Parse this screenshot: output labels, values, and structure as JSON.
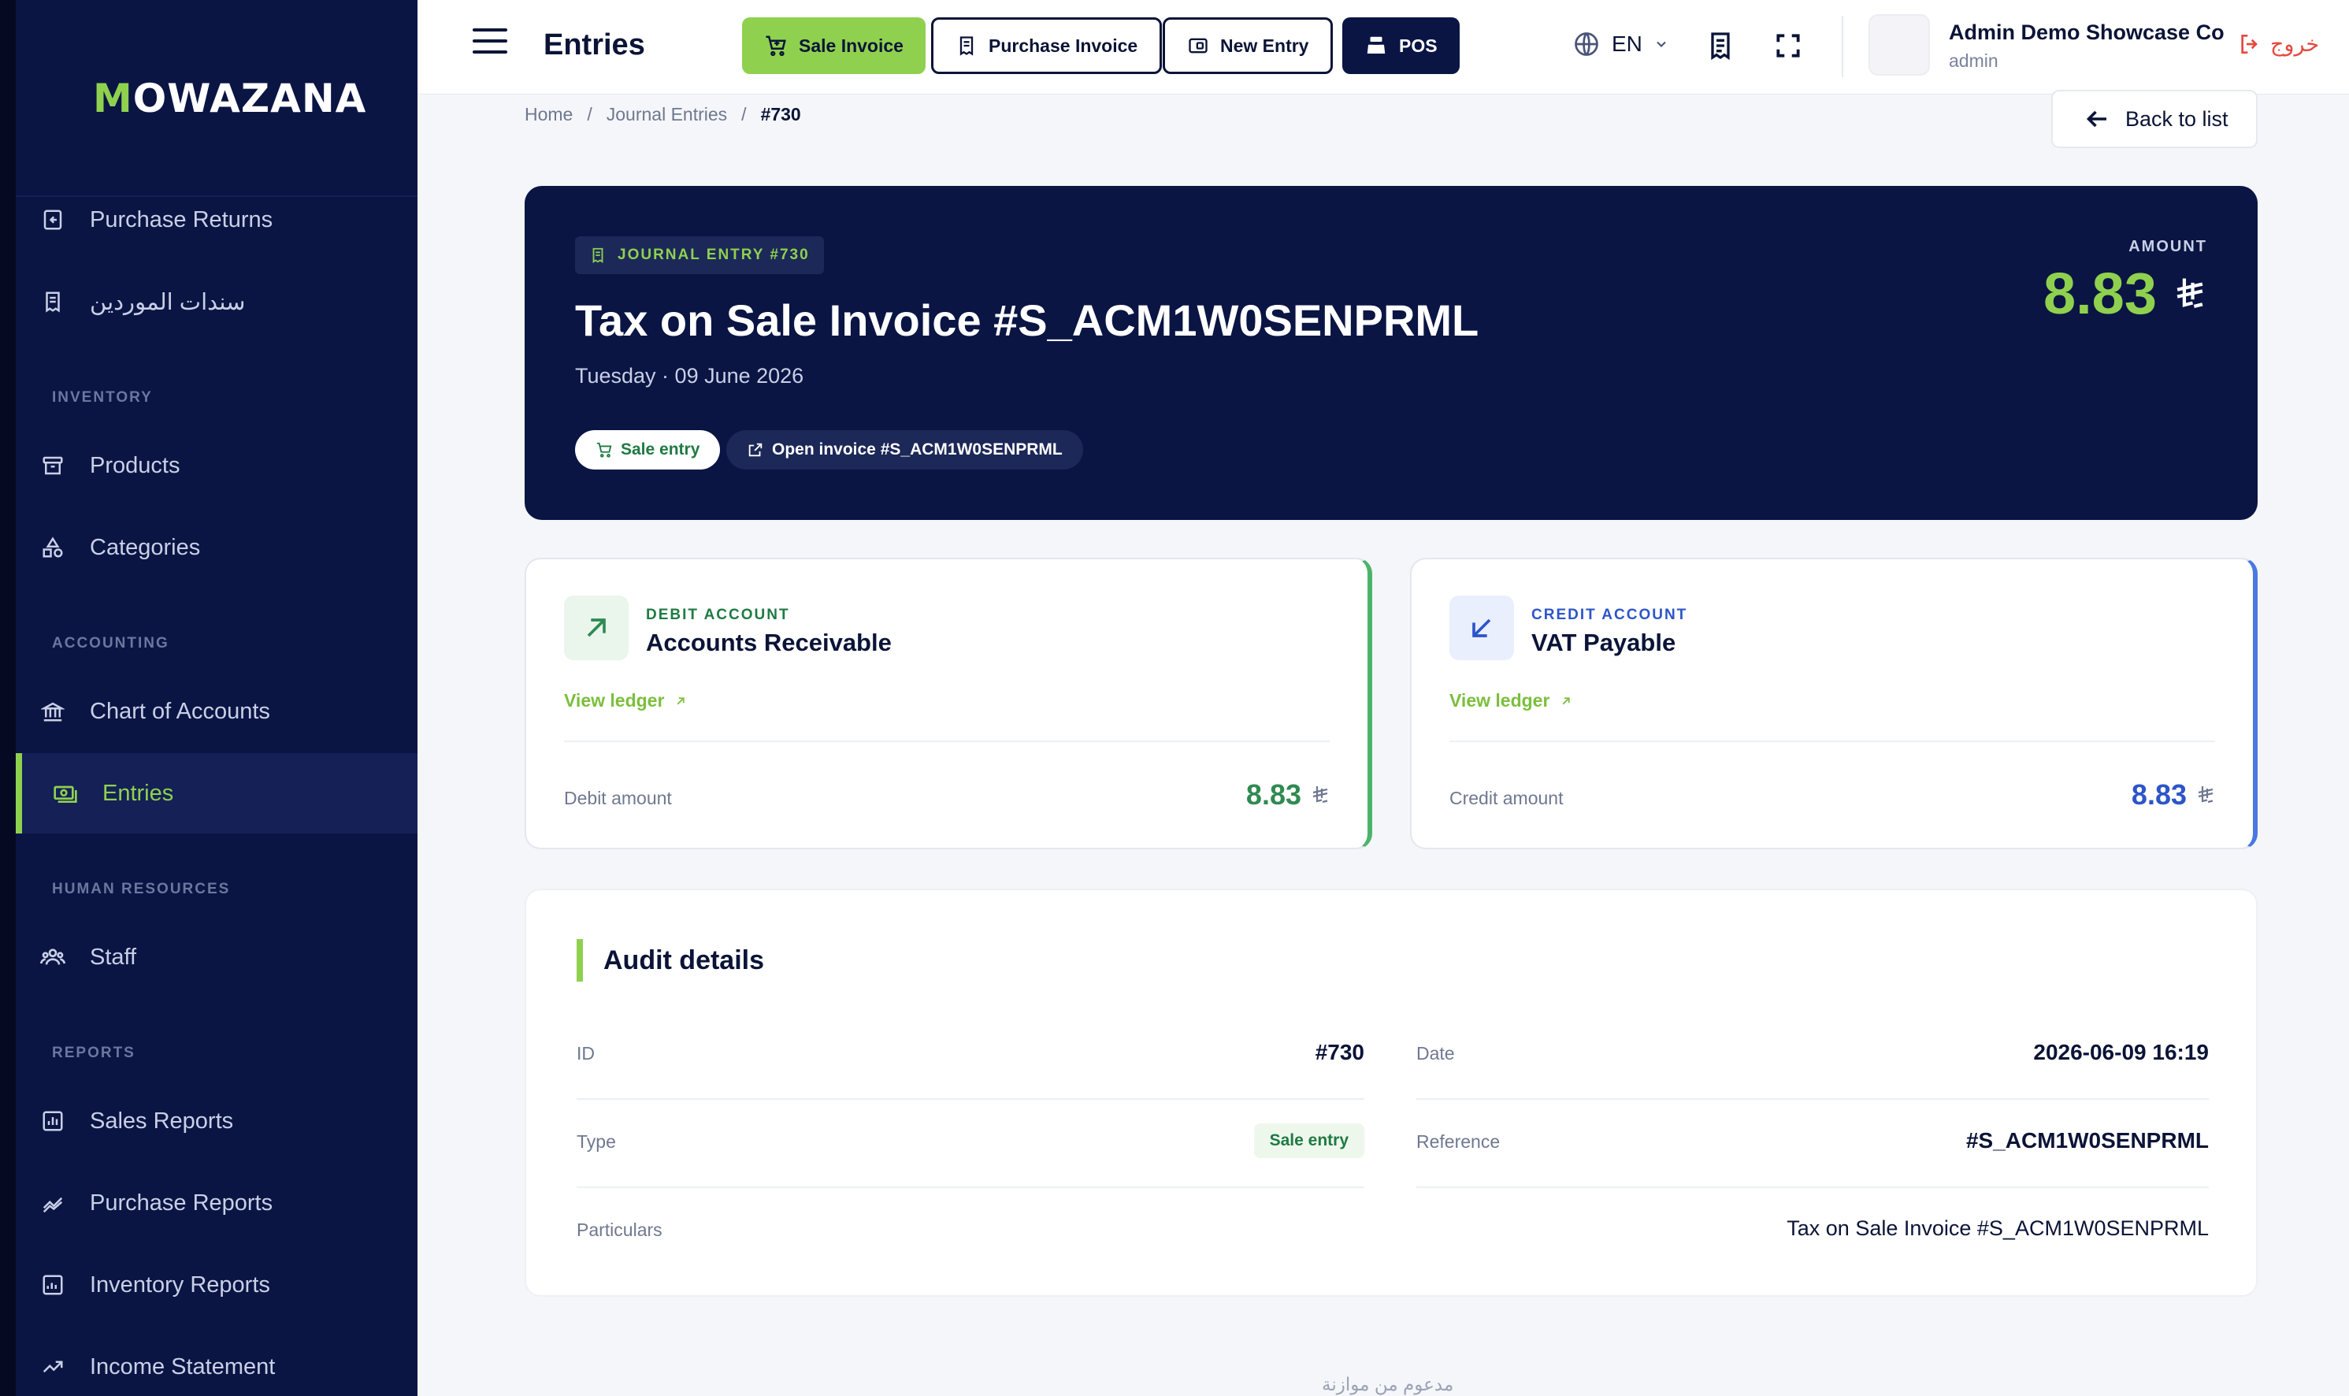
{
  "sidebar": {
    "logo": "MOWAZANA",
    "sections": {
      "inventory": "INVENTORY",
      "accounting": "ACCOUNTING",
      "hr": "HUMAN RESOURCES",
      "reports": "REPORTS"
    },
    "items": {
      "purchase_returns": "Purchase Returns",
      "supplier_vouchers": "سندات الموردين",
      "products": "Products",
      "categories": "Categories",
      "chart_of_accounts": "Chart of Accounts",
      "entries": "Entries",
      "staff": "Staff",
      "sales_reports": "Sales Reports",
      "purchase_reports": "Purchase Reports",
      "inventory_reports": "Inventory Reports",
      "income_statement": "Income Statement"
    },
    "active_item": "entries",
    "accent_color": "#8fd14f",
    "bg_color": "#0a1544"
  },
  "topbar": {
    "title": "Entries",
    "buttons": {
      "sale_invoice": "Sale Invoice",
      "purchase_invoice": "Purchase Invoice",
      "new_entry": "New Entry",
      "pos": "POS"
    },
    "language": "EN",
    "company": "Admin Demo Showcase Co",
    "role": "admin",
    "logout": "خروج"
  },
  "breadcrumb": {
    "home": "Home",
    "section": "Journal Entries",
    "current": "#730"
  },
  "back_button": "Back to list",
  "hero": {
    "tag": "JOURNAL ENTRY #730",
    "title": "Tax on Sale Invoice #S_ACM1W0SENPRML",
    "date": "Tuesday · 09 June 2026",
    "chip_type": "Sale entry",
    "chip_open": "Open invoice #S_ACM1W0SENPRML",
    "amount_label": "AMOUNT",
    "amount": "8.83"
  },
  "debit": {
    "label": "DEBIT ACCOUNT",
    "name": "Accounts Receivable",
    "ledger": "View ledger",
    "amount_label": "Debit amount",
    "amount": "8.83",
    "color": "#2f8a52"
  },
  "credit": {
    "label": "CREDIT ACCOUNT",
    "name": "VAT Payable",
    "ledger": "View ledger",
    "amount_label": "Credit amount",
    "amount": "8.83",
    "color": "#2d55c9"
  },
  "audit": {
    "title": "Audit details",
    "id_label": "ID",
    "id_value": "#730",
    "date_label": "Date",
    "date_value": "2026-06-09 16:19",
    "type_label": "Type",
    "type_value": "Sale entry",
    "reference_label": "Reference",
    "reference_value": "#S_ACM1W0SENPRML",
    "particulars_label": "Particulars",
    "particulars_value": "Tax on Sale Invoice #S_ACM1W0SENPRML"
  },
  "footer": "مدعوم من موازنة",
  "icons": [
    "menu-icon",
    "cart-icon",
    "receipt-icon",
    "wallet-icon",
    "cash-register-icon",
    "globe-icon",
    "chevron-down-icon",
    "document-icon",
    "fullscreen-icon",
    "logout-icon",
    "arrow-left-icon",
    "arrow-up-right-icon",
    "arrow-down-left-icon",
    "external-link-icon",
    "riyal-icon"
  ]
}
